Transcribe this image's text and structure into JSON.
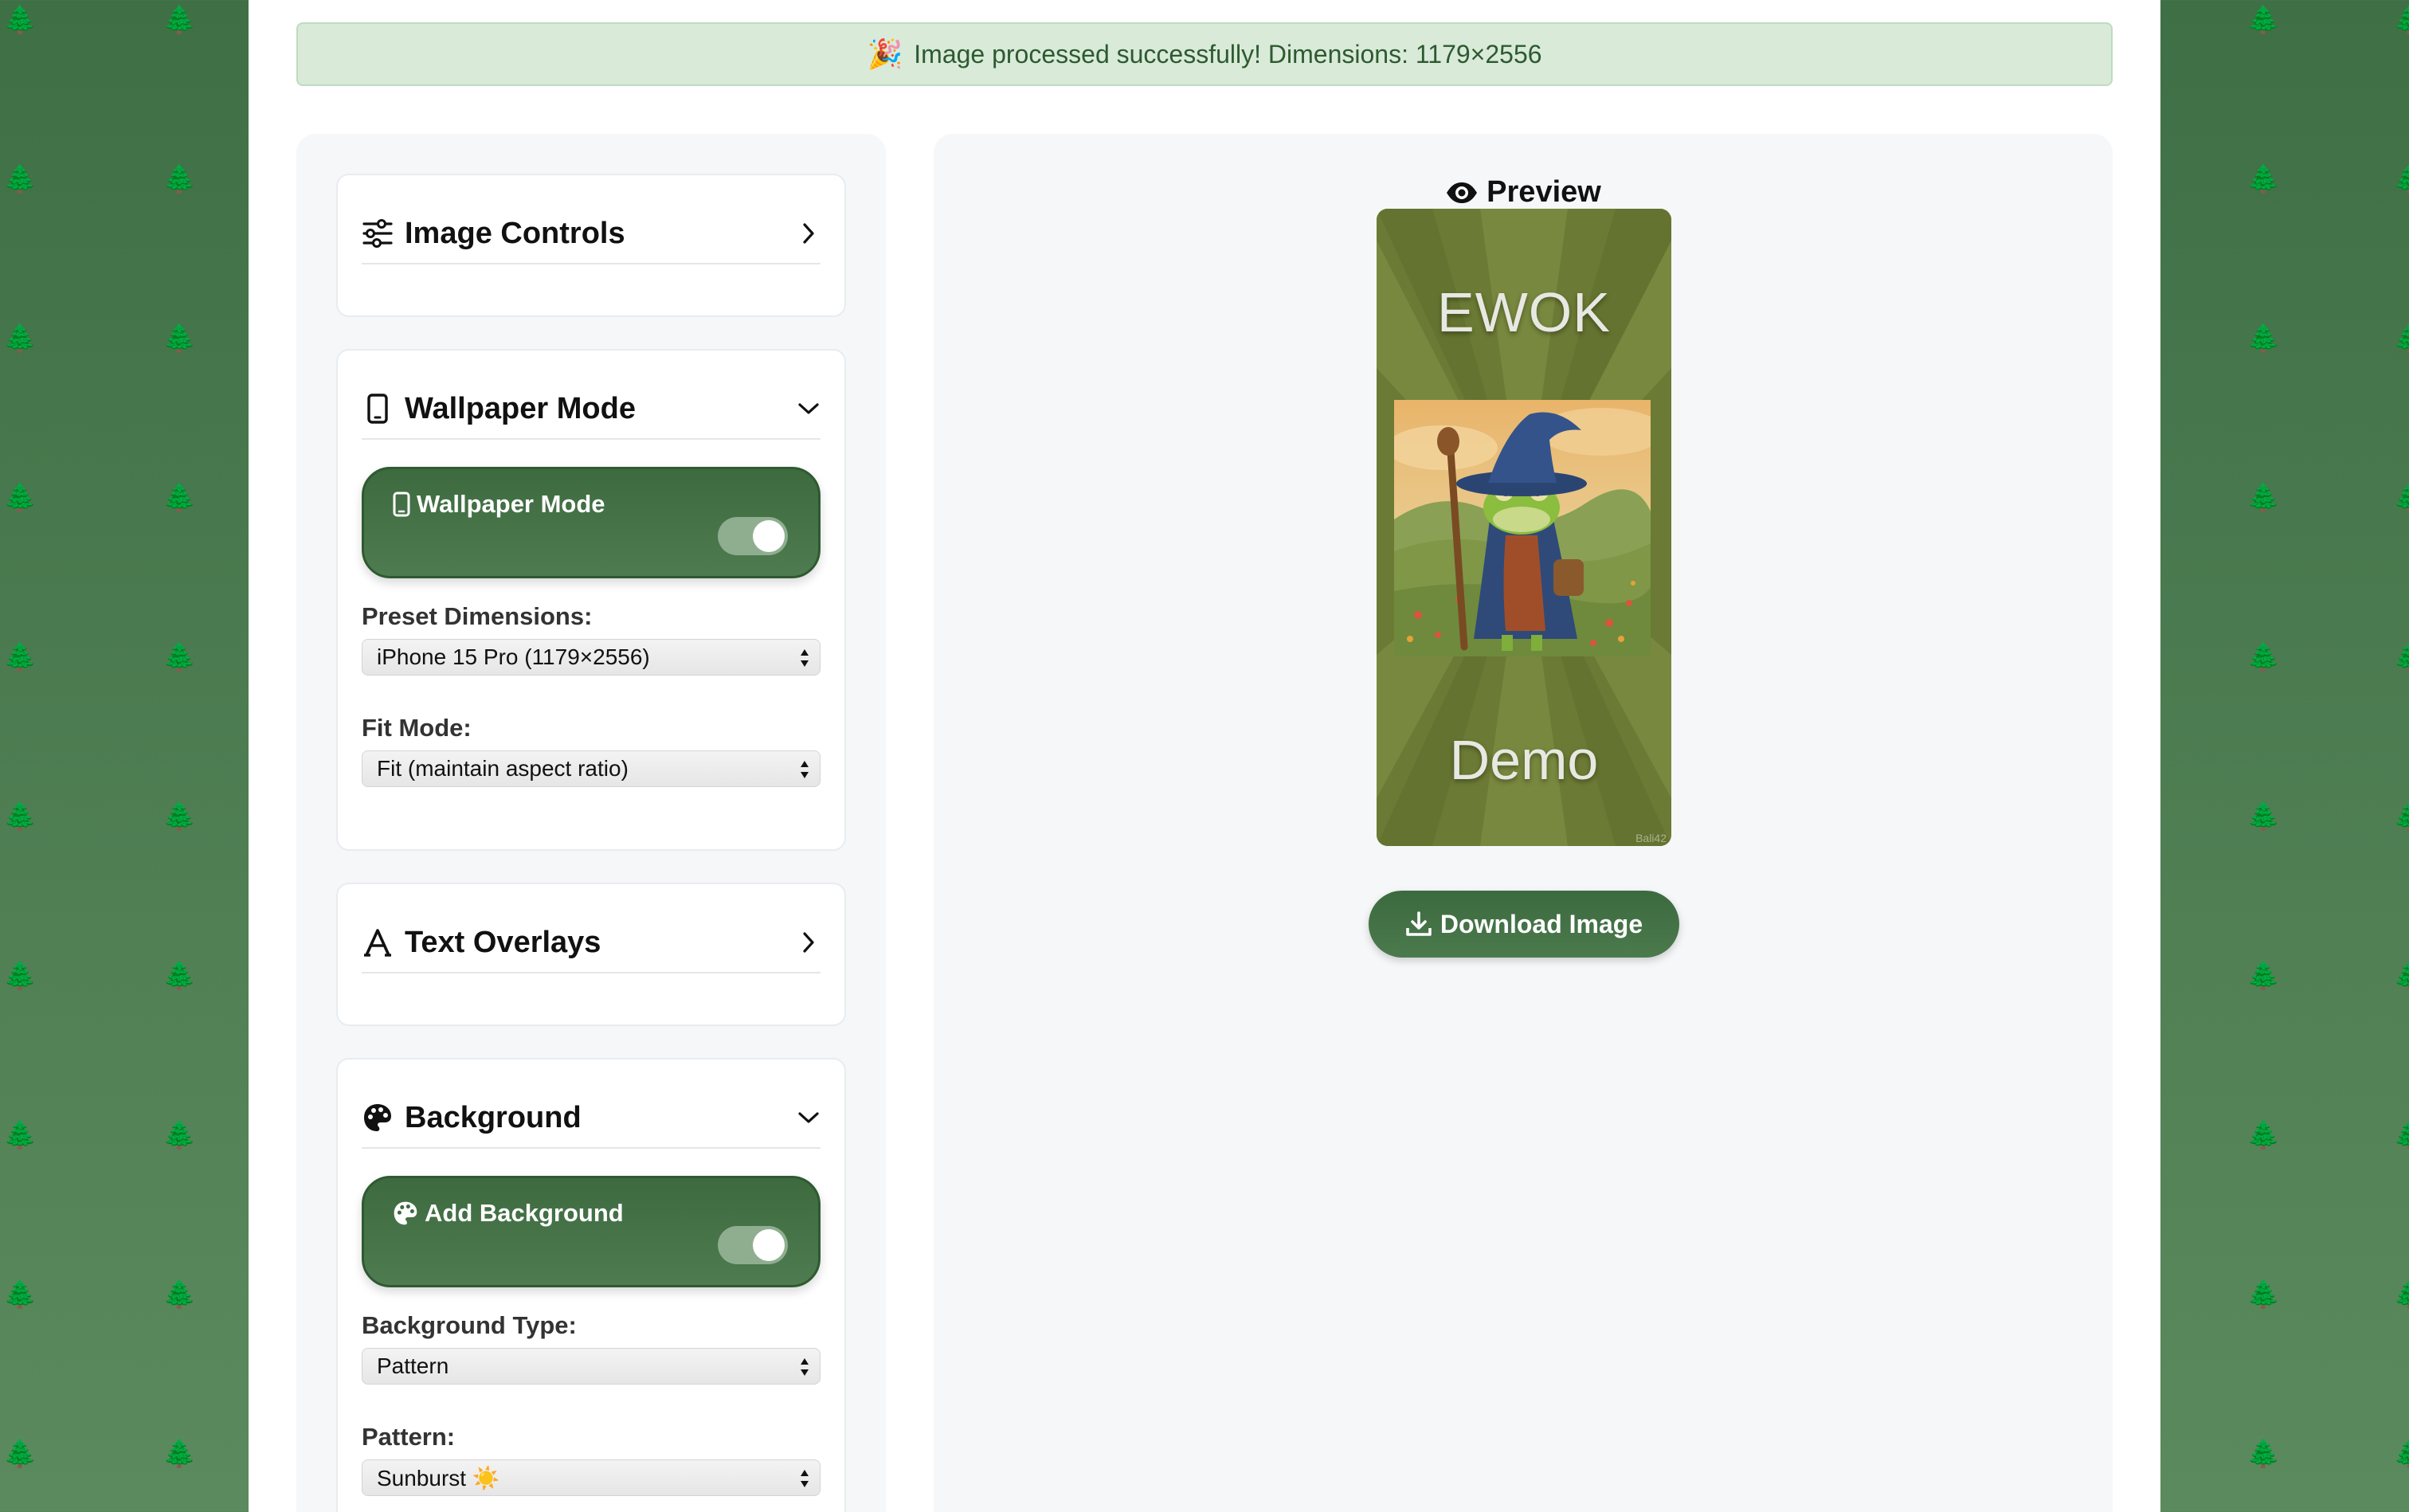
{
  "banner": {
    "emoji": "🎉",
    "text": "Image processed successfully! Dimensions: 1179×2556"
  },
  "sidebar": {
    "image_controls": {
      "title": "Image Controls",
      "icon": "sliders-icon",
      "expanded": false
    },
    "wallpaper_mode": {
      "title": "Wallpaper Mode",
      "icon": "phone-icon",
      "expanded": true,
      "toggle_label": "Wallpaper Mode",
      "toggle_on": true,
      "preset_label": "Preset Dimensions:",
      "preset_value": "iPhone 15 Pro (1179×2556)",
      "fit_label": "Fit Mode:",
      "fit_value": "Fit (maintain aspect ratio)"
    },
    "text_overlays": {
      "title": "Text Overlays",
      "icon": "text-a-icon",
      "expanded": false
    },
    "background": {
      "title": "Background",
      "icon": "palette-icon",
      "expanded": true,
      "toggle_label": "Add Background",
      "toggle_on": true,
      "type_label": "Background Type:",
      "type_value": "Pattern",
      "pattern_label": "Pattern:",
      "pattern_value": "Sunburst ☀️"
    }
  },
  "preview": {
    "title": "Preview",
    "icon": "eye-icon",
    "top_text": "EWOK",
    "bottom_text": "Demo",
    "watermark": "Bali42",
    "download_label": "Download Image",
    "download_icon": "download-icon"
  },
  "colors": {
    "accent": "#3d6a3f",
    "banner_bg": "#d9ead9",
    "banner_text": "#2d5a30",
    "page_bg": "#4d7a50",
    "preview_bg": "#6d7c35"
  }
}
